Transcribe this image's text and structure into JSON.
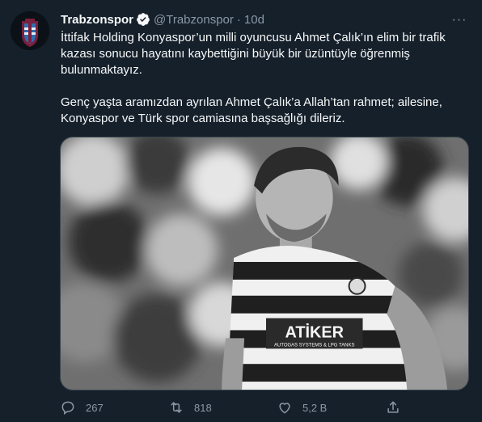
{
  "tweet": {
    "display_name": "Trabzonspor",
    "handle": "@Trabzonspor",
    "separator": "·",
    "time": "10d",
    "more_label": "···",
    "paragraphs": [
      "İttifak Holding Konyaspor’un milli oyuncusu Ahmet Çalık’ın elim bir trafik kazası sonucu hayatını kaybettiğini büyük bir üzüntüyle öğrenmiş bulunmaktayız.",
      "Genç yaşta aramızdan ayrılan Ahmet Çalık’a Allah’tan rahmet; ailesine, Konyaspor ve Türk spor camiasına başsağlığı dileriz."
    ],
    "media": {
      "sponsor_text": "ATİKER",
      "sponsor_subtext": "AUTOGAS SYSTEMS & LPG TANKS"
    },
    "actions": {
      "reply_count": "267",
      "retweet_count": "818",
      "like_count": "5,2 B"
    }
  },
  "colors": {
    "background": "#15202b",
    "text_primary": "#f7f9f9",
    "text_secondary": "#8b98a5",
    "verified_badge": "#1d9bf0",
    "media_border": "#38444d"
  },
  "icons": {
    "avatar": "trabzonspor-logo",
    "verified": "verified-badge-icon",
    "more": "more-icon",
    "reply": "reply-icon",
    "retweet": "retweet-icon",
    "like": "like-icon",
    "share": "share-icon"
  }
}
